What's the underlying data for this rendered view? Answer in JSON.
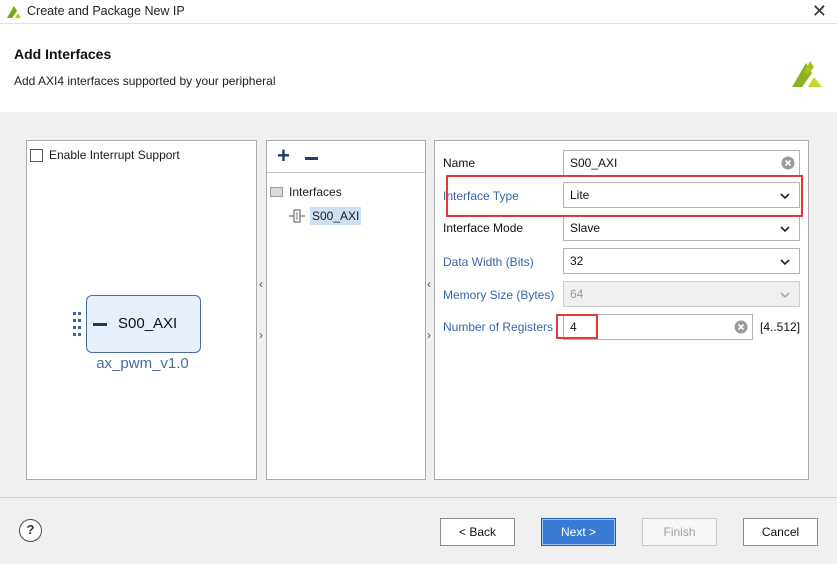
{
  "window": {
    "title": "Create and Package New IP",
    "close_glyph": "✕"
  },
  "header": {
    "title": "Add Interfaces",
    "subtitle": "Add AXI4 interfaces supported by your peripheral"
  },
  "left_panel": {
    "interrupt_checkbox_label": "Enable Interrupt Support",
    "interrupt_checked": false,
    "ip_block_label": "S00_AXI",
    "ip_name": "ax_pwm_v1.0"
  },
  "middle_panel": {
    "add_glyph": "+",
    "tree_root_label": "Interfaces",
    "tree_child_label": "S00_AXI",
    "arrow_left": "‹",
    "arrow_right": "›"
  },
  "right_panel": {
    "name": {
      "label": "Name",
      "value": "S00_AXI"
    },
    "interface_type": {
      "label": "Interface Type",
      "value": "Lite"
    },
    "interface_mode": {
      "label": "Interface Mode",
      "value": "Slave"
    },
    "data_width": {
      "label": "Data Width (Bits)",
      "value": "32"
    },
    "memory_size": {
      "label": "Memory Size (Bytes)",
      "value": "64"
    },
    "num_registers": {
      "label": "Number of Registers",
      "value": "4",
      "range": "[4..512]"
    }
  },
  "footer": {
    "help_label": "?",
    "back_label": "< Back",
    "next_label": "Next >",
    "finish_label": "Finish",
    "cancel_label": "Cancel"
  },
  "colors": {
    "accent": "#3a7bd5",
    "highlight": "#e5383b",
    "link_label": "#3b63a8"
  },
  "icons": [
    "xilinx-logo-icon",
    "close-icon",
    "add-icon",
    "remove-icon",
    "folder-icon",
    "interface-icon",
    "chevron-down-icon",
    "clear-icon",
    "help-icon",
    "grip-icon"
  ]
}
